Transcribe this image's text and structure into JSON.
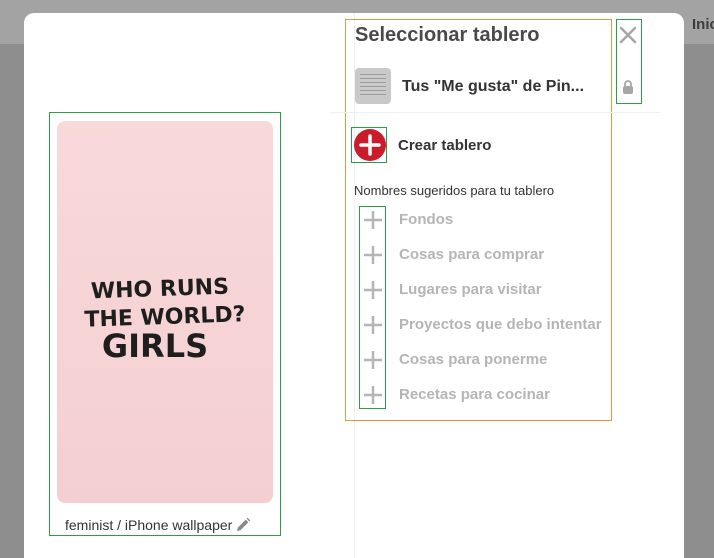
{
  "backdrop": {
    "right_label": "Inic"
  },
  "pin": {
    "image_text": [
      "WHO RUNS",
      "THE WORLD?",
      "GIRLS"
    ],
    "caption": "feminist / iPhone wallpaper",
    "edit_icon": "pencil-icon"
  },
  "board_picker": {
    "title": "Seleccionar tablero",
    "close_icon": "close-icon",
    "saved_board": {
      "label": "Tus \"Me gusta\" de Pin...",
      "secret_icon": "lock-icon"
    },
    "create_board_label": "Crear tablero",
    "suggestions_heading": "Nombres sugeridos para tu tablero",
    "suggestions": [
      "Fondos",
      "Cosas para comprar",
      "Lugares para visitar",
      "Proyectos que debo intentar",
      "Cosas para ponerme",
      "Recetas para cocinar"
    ]
  },
  "colors": {
    "accent_red": "#cb1c2c",
    "muted_text": "#b5b5b5",
    "highlight_green": "#2e9b4b",
    "highlight_orange": "#e09a3e"
  }
}
